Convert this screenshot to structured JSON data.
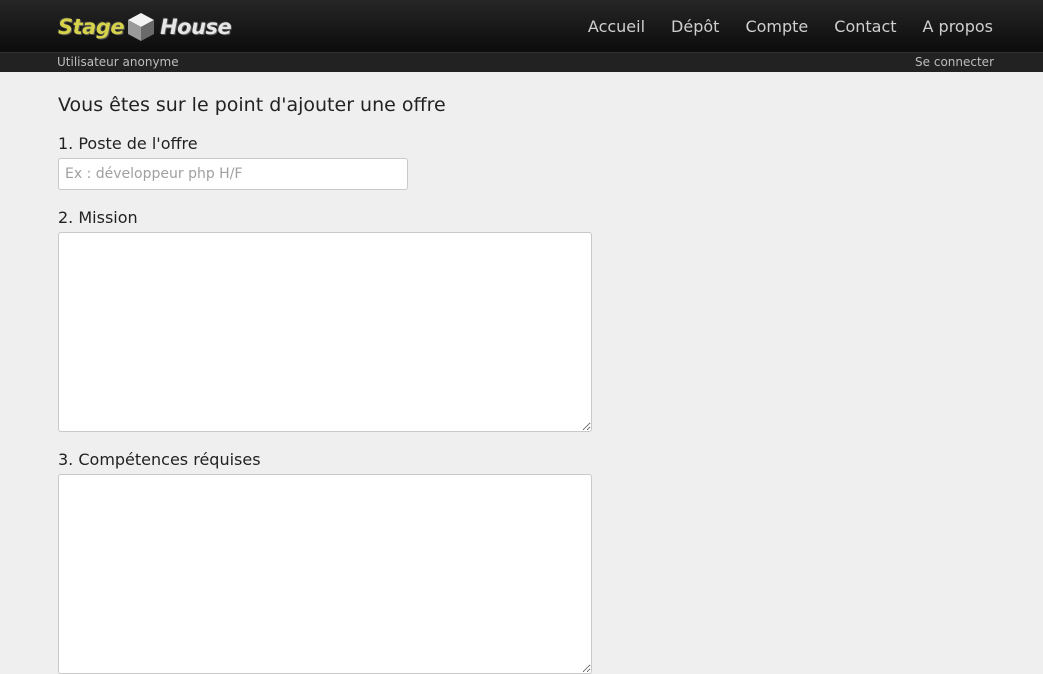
{
  "brand": {
    "part1": "Stage",
    "part2": "House"
  },
  "nav": {
    "items": [
      {
        "label": "Accueil",
        "name": "nav-accueil"
      },
      {
        "label": "Dépôt",
        "name": "nav-depot"
      },
      {
        "label": "Compte",
        "name": "nav-compte"
      },
      {
        "label": "Contact",
        "name": "nav-contact"
      },
      {
        "label": "A propos",
        "name": "nav-apropos"
      }
    ]
  },
  "subbar": {
    "user": "Utilisateur anonyme",
    "login": "Se connecter"
  },
  "page": {
    "title": "Vous êtes sur le point d'ajouter une offre"
  },
  "form": {
    "poste": {
      "label": "1. Poste de l'offre",
      "placeholder": "Ex : développeur php H/F",
      "value": ""
    },
    "mission": {
      "label": "2. Mission",
      "value": ""
    },
    "competences": {
      "label": "3. Compétences réquises",
      "value": ""
    }
  },
  "colors": {
    "brand_yellow": "#d6d24a",
    "background": "#efefef",
    "header": "#111111"
  }
}
